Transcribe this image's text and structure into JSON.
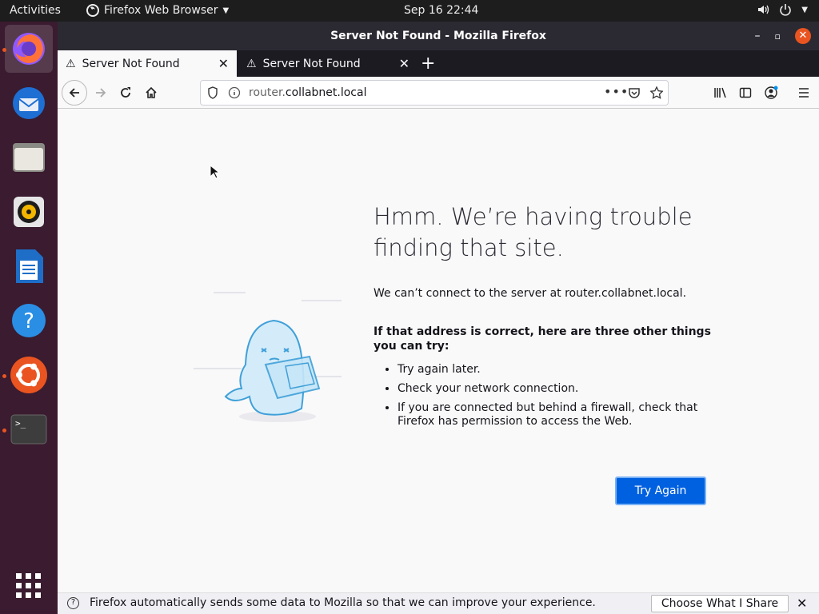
{
  "topbar": {
    "activities": "Activities",
    "app_menu": "Firefox Web Browser",
    "clock": "Sep 16  22:44"
  },
  "dock": {
    "items": [
      "firefox-icon",
      "thunderbird-icon",
      "files-icon",
      "rhythmbox-icon",
      "writer-icon",
      "help-icon",
      "ubuntu-software-icon",
      "terminal-icon",
      "show-apps-icon"
    ]
  },
  "window": {
    "title": "Server Not Found - Mozilla Firefox"
  },
  "tabs": [
    {
      "label": "Server Not Found"
    },
    {
      "label": "Server Not Found"
    }
  ],
  "urlbar": {
    "prefix": "router.",
    "domain": "collabnet.local"
  },
  "error_page": {
    "heading": "Hmm. We’re having trouble finding that site.",
    "description": "We can’t connect to the server at router.collabnet.local.",
    "tips_heading": "If that address is correct, here are three other things you can try:",
    "tips": [
      "Try again later.",
      "Check your network connection.",
      "If you are connected but behind a firewall, check that Firefox has permission to access the Web."
    ],
    "button": "Try Again"
  },
  "notification": {
    "text": "Firefox automatically sends some data to Mozilla so that we can improve your experience.",
    "button": "Choose What I Share"
  },
  "colors": {
    "accent": "#0061e0",
    "ubuntu_orange": "#e95420",
    "dock_bg": "#3a1b2f"
  }
}
